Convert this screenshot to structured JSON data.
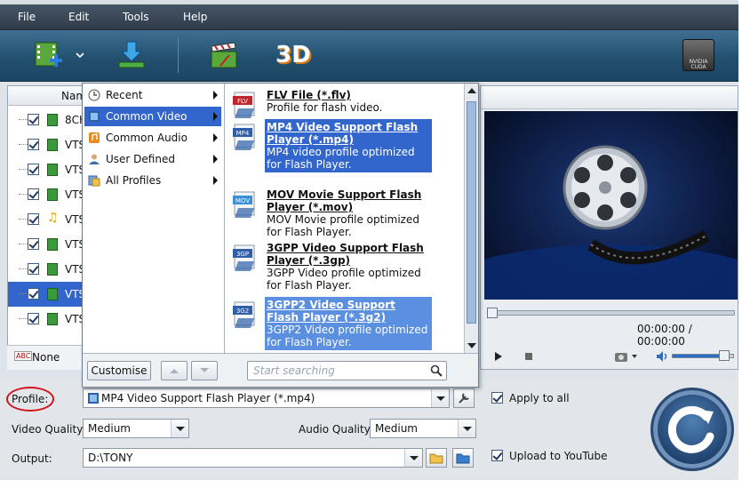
{
  "menu": [
    "File",
    "Edit",
    "Tools",
    "Help"
  ],
  "filelist": {
    "header_name": "Nam",
    "rows": [
      {
        "name": "8CH",
        "type": "video"
      },
      {
        "name": "VTS",
        "type": "video"
      },
      {
        "name": "VTS",
        "type": "video"
      },
      {
        "name": "VTS",
        "type": "video"
      },
      {
        "name": "VTS",
        "type": "music"
      },
      {
        "name": "VTS",
        "type": "video"
      },
      {
        "name": "VTS",
        "type": "video"
      },
      {
        "name": "VTS",
        "type": "video",
        "selected": true
      },
      {
        "name": "VTS",
        "type": "video"
      }
    ],
    "subtitle_value": "None",
    "subtitle_icon_text": "ABC"
  },
  "toolbar": {
    "threed_label": "3D",
    "cuda_label": "NVIDIA CUDA"
  },
  "profile_menu": {
    "categories": [
      {
        "label": "Recent",
        "icon": "clock-icon"
      },
      {
        "label": "Common Video",
        "icon": "film-icon",
        "selected": true
      },
      {
        "label": "Common Audio",
        "icon": "audio-icon"
      },
      {
        "label": "User Defined",
        "icon": "user-icon"
      },
      {
        "label": "All Profiles",
        "icon": "profiles-icon"
      }
    ],
    "profiles": [
      {
        "title": "FLV File (*.flv)",
        "desc": "Profile for flash video.",
        "badge": "FLV"
      },
      {
        "title": "MP4 Video Support Flash Player (*.mp4)",
        "desc": "MP4 video profile optimized for Flash Player.",
        "badge": "MP4",
        "selected": true
      },
      {
        "title": "MOV Movie Support Flash Player (*.mov)",
        "desc": "MOV Movie profile optimized for Flash Player.",
        "badge": "MOV"
      },
      {
        "title": "3GPP Video Support Flash Player (*.3gp)",
        "desc": "3GPP Video profile optimized for Flash Player.",
        "badge": "3GP"
      },
      {
        "title": "3GPP2 Video Support Flash Player (*.3g2)",
        "desc": "3GPP2 Video profile optimized for Flash Player.",
        "badge": "3G2",
        "hover": true
      }
    ],
    "customise_label": "Customise",
    "search_placeholder": "Start searching"
  },
  "preview": {
    "timecode": "00:00:00 / 00:00:00",
    "progress": 0,
    "volume": 0.85
  },
  "options": {
    "profile_label": "Profile:",
    "profile_value": "MP4 Video Support Flash Player (*.mp4)",
    "apply_all_label": "Apply to all",
    "video_quality_label": "Video Quality:",
    "video_quality_value": "Medium",
    "audio_quality_label": "Audio Quality:",
    "audio_quality_value": "Medium",
    "output_label": "Output:",
    "output_value": "D:\\TONY",
    "upload_label": "Upload to YouTube"
  },
  "colors": {
    "selection": "#3366cc",
    "annotation_circle": "#d4141b"
  }
}
